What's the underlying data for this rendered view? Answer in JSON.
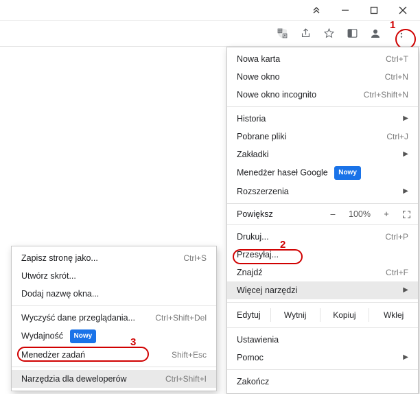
{
  "toolbar": {
    "translate_icon": "translate-icon",
    "share_icon": "share-icon",
    "star_icon": "star-icon",
    "sidepanel_icon": "side-panel-icon",
    "profile_icon": "profile-icon",
    "menu_icon": "kebab-menu-icon"
  },
  "mainMenu": {
    "newTab": {
      "label": "Nowa karta",
      "shortcut": "Ctrl+T"
    },
    "newWindow": {
      "label": "Nowe okno",
      "shortcut": "Ctrl+N"
    },
    "newIncognito": {
      "label": "Nowe okno incognito",
      "shortcut": "Ctrl+Shift+N"
    },
    "history": {
      "label": "Historia"
    },
    "downloads": {
      "label": "Pobrane pliki",
      "shortcut": "Ctrl+J"
    },
    "bookmarks": {
      "label": "Zakładki"
    },
    "pwManager": {
      "label": "Menedżer haseł Google",
      "badge": "Nowy"
    },
    "extensions": {
      "label": "Rozszerzenia"
    },
    "zoom": {
      "label": "Powiększ",
      "minus": "–",
      "value": "100%",
      "plus": "+"
    },
    "print": {
      "label": "Drukuj...",
      "shortcut": "Ctrl+P"
    },
    "cast": {
      "label": "Przesyłaj..."
    },
    "find": {
      "label": "Znajdź",
      "shortcut": "Ctrl+F"
    },
    "moreTools": {
      "label": "Więcej narzędzi"
    },
    "edit": {
      "label": "Edytuj",
      "cut": "Wytnij",
      "copy": "Kopiuj",
      "paste": "Wklej"
    },
    "settings": {
      "label": "Ustawienia"
    },
    "help": {
      "label": "Pomoc"
    },
    "exit": {
      "label": "Zakończ"
    }
  },
  "subMenu": {
    "savePage": {
      "label": "Zapisz stronę jako...",
      "shortcut": "Ctrl+S"
    },
    "shortcut": {
      "label": "Utwórz skrót..."
    },
    "nameWindow": {
      "label": "Dodaj nazwę okna..."
    },
    "clearData": {
      "label": "Wyczyść dane przeglądania...",
      "shortcut": "Ctrl+Shift+Del"
    },
    "perf": {
      "label": "Wydajność",
      "badge": "Nowy"
    },
    "taskMgr": {
      "label": "Menedżer zadań",
      "shortcut": "Shift+Esc"
    },
    "devTools": {
      "label": "Narzędzia dla deweloperów",
      "shortcut": "Ctrl+Shift+I"
    }
  },
  "annotations": {
    "n1": "1",
    "n2": "2",
    "n3": "3"
  }
}
